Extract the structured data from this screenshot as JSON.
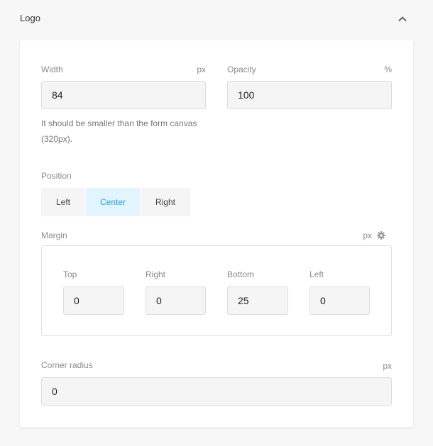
{
  "section": {
    "title": "Logo"
  },
  "width": {
    "label": "Width",
    "unit": "px",
    "value": "84",
    "help": "It should be smaller than the form canvas (320px)."
  },
  "opacity": {
    "label": "Opacity",
    "unit": "%",
    "value": "100"
  },
  "position": {
    "label": "Position",
    "options": [
      "Left",
      "Center",
      "Right"
    ],
    "selected": "Center"
  },
  "margin": {
    "label": "Margin",
    "unit": "px",
    "fields": [
      {
        "label": "Top",
        "value": "0"
      },
      {
        "label": "Right",
        "value": "0"
      },
      {
        "label": "Bottom",
        "value": "25"
      },
      {
        "label": "Left",
        "value": "0"
      }
    ]
  },
  "corner_radius": {
    "label": "Corner radius",
    "unit": "px",
    "value": "0"
  },
  "colors": {
    "accent": "#2a9fd8",
    "accent_bg": "#e2f4fd",
    "page_bg": "#f7f7f7"
  },
  "icons": {
    "collapse": "chevron-up-icon",
    "settings": "gear-icon"
  }
}
